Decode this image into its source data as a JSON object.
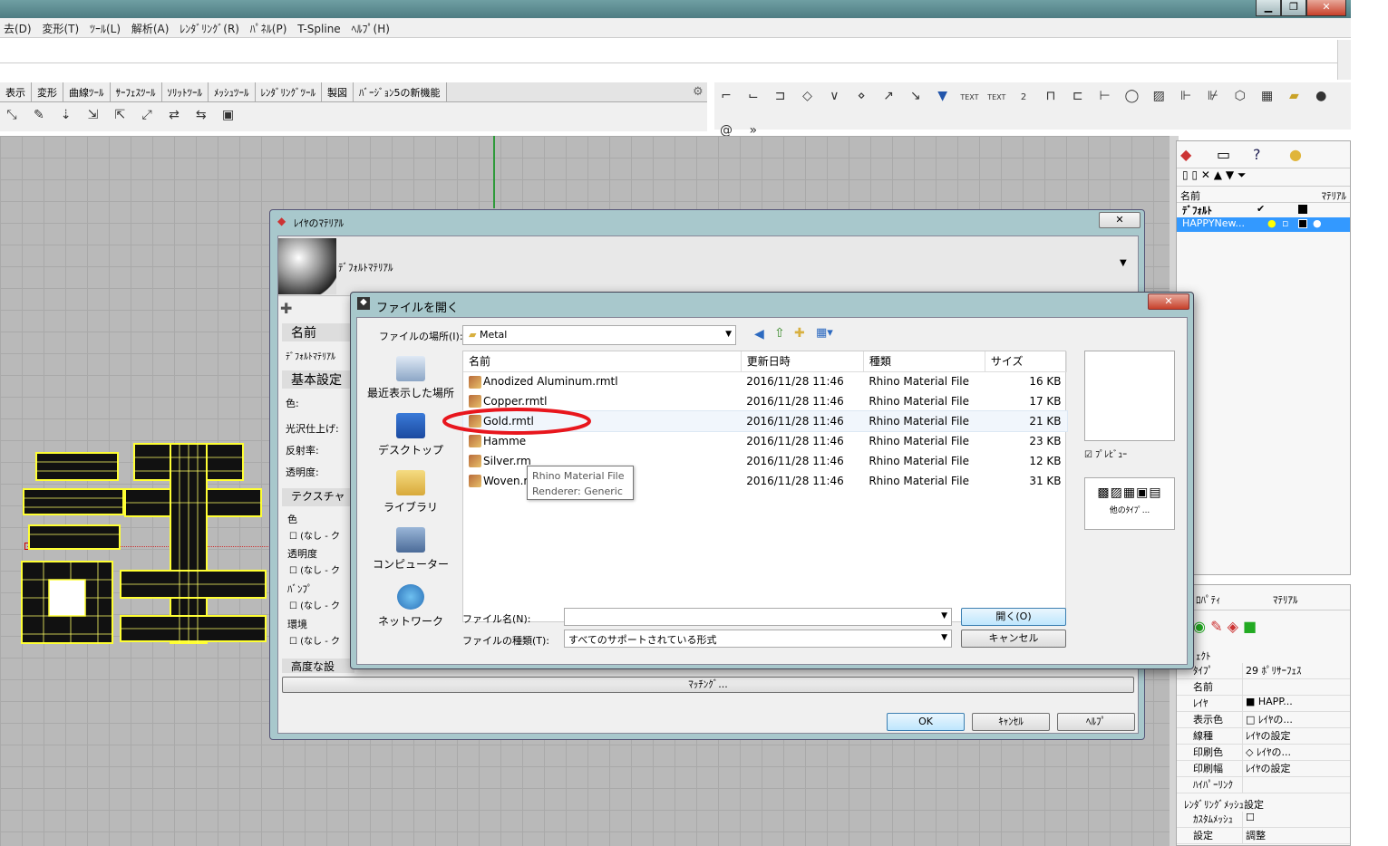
{
  "app": {
    "window_controls": {
      "minimize": "▁",
      "maximize": "❐",
      "close": "✕"
    },
    "menu": [
      "去(D)",
      "変形(T)",
      "ﾂｰﾙ(L)",
      "解析(A)",
      "ﾚﾝﾀﾞﾘﾝｸﾞ(R)",
      "ﾊﾟﾈﾙ(P)",
      "T-Spline",
      "ﾍﾙﾌﾟ(H)"
    ],
    "tabs": [
      "表示",
      "変形",
      "曲線ﾂｰﾙ",
      "ｻｰﾌｪｽﾂｰﾙ",
      "ｿﾘｯﾄﾂｰﾙ",
      "ﾒｯｼｭﾂｰﾙ",
      "ﾚﾝﾀﾞﾘﾝｸﾞﾂｰﾙ",
      "製図",
      "ﾊﾞｰｼﾞｮﾝ5の新機能"
    ],
    "toolbar_right_labels": [
      "TEXT",
      "TEXT",
      "2"
    ]
  },
  "layers_panel": {
    "col_name": "名前",
    "col_material": "ﾏﾃﾘｱﾙ",
    "layers": [
      {
        "name": "ﾃﾞﾌｫﾙﾄ",
        "current": "✔"
      },
      {
        "name": "HAPPYNew..."
      }
    ]
  },
  "properties_panel": {
    "tabs": [
      "ﾌﾟﾛﾊﾟﾃｨ",
      "ﾏﾃﾘｱﾙ"
    ],
    "section_object": "ｼﾞｪｸﾄ",
    "rows": [
      {
        "k": "ﾀｲﾌﾟ",
        "v": "29 ﾎﾟﾘｻｰﾌｪｽ"
      },
      {
        "k": "名前",
        "v": ""
      },
      {
        "k": "ﾚｲﾔ",
        "v": "■ HAPP..."
      },
      {
        "k": "表示色",
        "v": "□ ﾚｲﾔの..."
      },
      {
        "k": "線種",
        "v": "ﾚｲﾔの設定"
      },
      {
        "k": "印刷色",
        "v": "◇ ﾚｲﾔの..."
      },
      {
        "k": "印刷幅",
        "v": "ﾚｲﾔの設定"
      },
      {
        "k": "ﾊｲﾊﾟｰﾘﾝｸ",
        "v": ""
      }
    ],
    "section_render": "ﾚﾝﾀﾞﾘﾝｸﾞﾒｯｼｭ設定",
    "custom_mesh": "ｶｽﾀﾑﾒｯｼｭ",
    "settings": "設定",
    "adjust": "調整"
  },
  "layer_material_dialog": {
    "title": "ﾚｲﾔのﾏﾃﾘｱﾙ",
    "material_name": "ﾃﾞﾌｫﾙﾄﾏﾃﾘｱﾙ",
    "name_header": "名前",
    "name_value": "ﾃﾞﾌｫﾙﾄﾏﾃﾘｱﾙ",
    "basic_header": "基本設定",
    "color_label": "色:",
    "gloss_label": "光沢仕上げ:",
    "reflect_label": "反射率:",
    "transp_label": "透明度:",
    "texture_header": "テクスチャ",
    "tex_color": "色",
    "tex_transp": "透明度",
    "tex_bump": "ﾊﾞﾝﾌﾟ",
    "tex_env": "環境",
    "none": "(なし - ク",
    "advanced_header": "高度な設",
    "matching": "ﾏｯﾁﾝｸﾞ...",
    "ok": "OK",
    "cancel": "ｷｬﾝｾﾙ",
    "help": "ﾍﾙﾌﾟ"
  },
  "open_dialog": {
    "title": "ファイルを開く",
    "location_label": "ファイルの場所(I):",
    "location_value": "Metal",
    "places": [
      "最近表示した場所",
      "デスクトップ",
      "ライブラリ",
      "コンピューター",
      "ネットワーク"
    ],
    "columns": [
      "名前",
      "更新日時",
      "種類",
      "サイズ"
    ],
    "files": [
      {
        "name": "Anodized Aluminum.rmtl",
        "date": "2016/11/28 11:46",
        "type": "Rhino Material File",
        "size": "16 KB"
      },
      {
        "name": "Copper.rmtl",
        "date": "2016/11/28 11:46",
        "type": "Rhino Material File",
        "size": "17 KB"
      },
      {
        "name": "Gold.rmtl",
        "date": "2016/11/28 11:46",
        "type": "Rhino Material File",
        "size": "21 KB"
      },
      {
        "name": "Hamme",
        "date": "2016/11/28 11:46",
        "type": "Rhino Material File",
        "size": "23 KB"
      },
      {
        "name": "Silver.rm",
        "date": "2016/11/28 11:46",
        "type": "Rhino Material File",
        "size": "12 KB"
      },
      {
        "name": "Woven.rmtl",
        "date": "2016/11/28 11:46",
        "type": "Rhino Material File",
        "size": "31 KB"
      }
    ],
    "tooltip_line1": "Rhino Material File",
    "tooltip_line2": "Renderer: Generic",
    "preview_label": "ﾌﾟﾚﾋﾞｭｰ",
    "other_types": "他のﾀｲﾌﾟ...",
    "filename_label": "ファイル名(N):",
    "filename_value": "",
    "filetype_label": "ファイルの種類(T):",
    "filetype_value": "すべてのサポートされている形式",
    "open_btn": "開く(O)",
    "cancel_btn": "キャンセル"
  },
  "colors": {
    "highlight_circle": "#e8161d",
    "selection": "#3399ff"
  }
}
